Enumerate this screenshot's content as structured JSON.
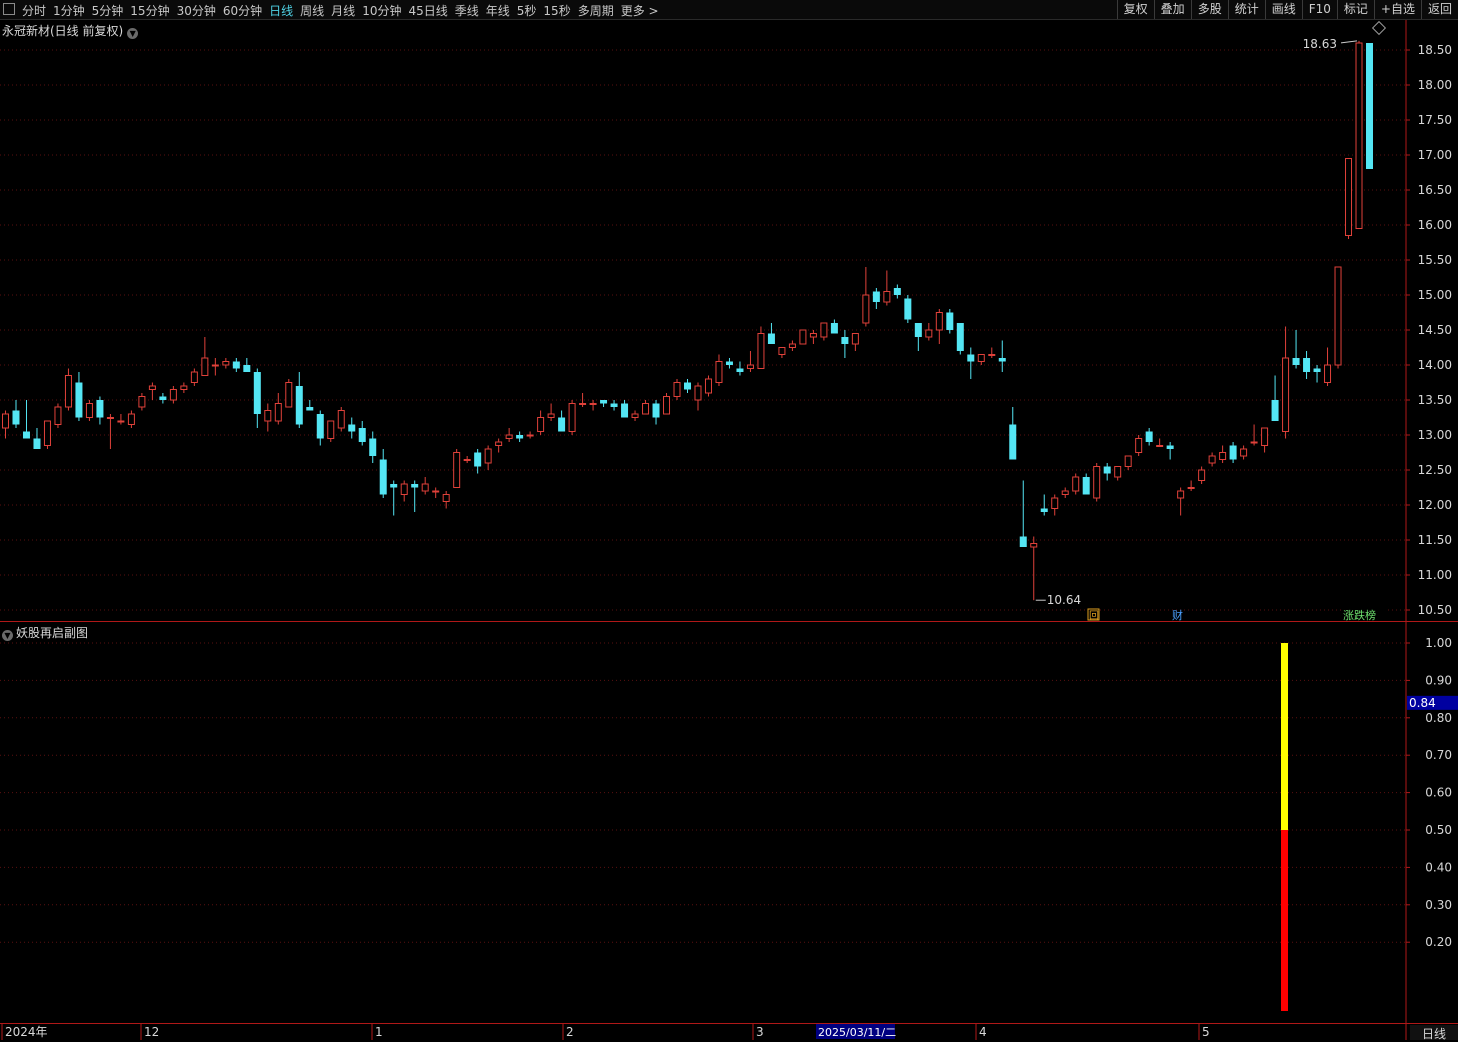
{
  "toolbar": {
    "tabs": [
      "分时",
      "1分钟",
      "5分钟",
      "15分钟",
      "30分钟",
      "60分钟",
      "日线",
      "周线",
      "月线",
      "10分钟",
      "45日线",
      "季线",
      "年线",
      "5秒",
      "15秒",
      "多周期",
      "更多 >"
    ],
    "active_tab": "日线",
    "right_buttons": [
      "复权",
      "叠加",
      "多股",
      "统计",
      "画线",
      "F10",
      "标记",
      "+自选",
      "返回"
    ]
  },
  "main_chart": {
    "title": "永冠新材(日线 前复权)",
    "price_axis": [
      "18.50",
      "18.00",
      "17.50",
      "17.00",
      "16.50",
      "16.00",
      "15.50",
      "15.00",
      "14.50",
      "14.00",
      "13.50",
      "13.00",
      "12.50",
      "12.00",
      "11.50",
      "11.00",
      "10.50"
    ],
    "high_label": "18.63",
    "low_label": "10.64",
    "markers": {
      "hui": "回",
      "cai": "财",
      "tags": "涨跌榜"
    }
  },
  "sub_chart": {
    "title": "妖股再启副图",
    "axis": [
      "1.00",
      "0.90",
      "0.80",
      "0.70",
      "0.60",
      "0.50",
      "0.40",
      "0.30",
      "0.20"
    ],
    "current_value": "0.84"
  },
  "time_axis": {
    "labels": [
      "2024年",
      "12",
      "1",
      "2",
      "3",
      "4",
      "5"
    ],
    "highlight_date": "2025/03/11/二",
    "period": "日线"
  },
  "colors": {
    "up": "#e0413a",
    "down": "#54e6f4",
    "grid": "#5a1010",
    "axis_line": "#b01818",
    "yellow": "#ffff00",
    "red_bar": "#ff0000"
  },
  "chart_data": {
    "type": "candlestick",
    "ylim": [
      10.4,
      18.8
    ],
    "candles": [
      {
        "o": 13.1,
        "h": 13.35,
        "l": 12.95,
        "c": 13.3
      },
      {
        "o": 13.35,
        "h": 13.5,
        "l": 13.1,
        "c": 13.15
      },
      {
        "o": 13.05,
        "h": 13.5,
        "l": 13.0,
        "c": 12.95
      },
      {
        "o": 12.95,
        "h": 13.1,
        "l": 12.8,
        "c": 12.8
      },
      {
        "o": 12.85,
        "h": 13.2,
        "l": 12.8,
        "c": 13.2
      },
      {
        "o": 13.15,
        "h": 13.45,
        "l": 13.1,
        "c": 13.4
      },
      {
        "o": 13.4,
        "h": 13.95,
        "l": 13.35,
        "c": 13.85
      },
      {
        "o": 13.75,
        "h": 13.9,
        "l": 13.2,
        "c": 13.25
      },
      {
        "o": 13.25,
        "h": 13.5,
        "l": 13.2,
        "c": 13.45
      },
      {
        "o": 13.5,
        "h": 13.55,
        "l": 13.15,
        "c": 13.25
      },
      {
        "o": 13.25,
        "h": 13.3,
        "l": 12.8,
        "c": 13.25
      },
      {
        "o": 13.2,
        "h": 13.3,
        "l": 13.15,
        "c": 13.2
      },
      {
        "o": 13.15,
        "h": 13.35,
        "l": 13.1,
        "c": 13.3
      },
      {
        "o": 13.4,
        "h": 13.6,
        "l": 13.35,
        "c": 13.55
      },
      {
        "o": 13.65,
        "h": 13.75,
        "l": 13.5,
        "c": 13.7
      },
      {
        "o": 13.55,
        "h": 13.6,
        "l": 13.45,
        "c": 13.5
      },
      {
        "o": 13.5,
        "h": 13.7,
        "l": 13.45,
        "c": 13.65
      },
      {
        "o": 13.65,
        "h": 13.75,
        "l": 13.6,
        "c": 13.7
      },
      {
        "o": 13.75,
        "h": 13.95,
        "l": 13.7,
        "c": 13.9
      },
      {
        "o": 13.85,
        "h": 14.4,
        "l": 13.85,
        "c": 14.1
      },
      {
        "o": 14.0,
        "h": 14.1,
        "l": 13.85,
        "c": 14.0
      },
      {
        "o": 14.0,
        "h": 14.1,
        "l": 13.95,
        "c": 14.05
      },
      {
        "o": 14.05,
        "h": 14.1,
        "l": 13.9,
        "c": 13.95
      },
      {
        "o": 14.0,
        "h": 14.1,
        "l": 13.9,
        "c": 13.9
      },
      {
        "o": 13.9,
        "h": 13.95,
        "l": 13.1,
        "c": 13.3
      },
      {
        "o": 13.2,
        "h": 13.45,
        "l": 13.05,
        "c": 13.35
      },
      {
        "o": 13.2,
        "h": 13.6,
        "l": 13.15,
        "c": 13.45
      },
      {
        "o": 13.4,
        "h": 13.8,
        "l": 13.4,
        "c": 13.75
      },
      {
        "o": 13.7,
        "h": 13.9,
        "l": 13.1,
        "c": 13.15
      },
      {
        "o": 13.4,
        "h": 13.5,
        "l": 13.35,
        "c": 13.35
      },
      {
        "o": 13.3,
        "h": 13.35,
        "l": 12.85,
        "c": 12.95
      },
      {
        "o": 12.95,
        "h": 13.1,
        "l": 12.9,
        "c": 13.2
      },
      {
        "o": 13.1,
        "h": 13.4,
        "l": 13.05,
        "c": 13.35
      },
      {
        "o": 13.15,
        "h": 13.25,
        "l": 12.95,
        "c": 13.05
      },
      {
        "o": 13.1,
        "h": 13.2,
        "l": 12.85,
        "c": 12.9
      },
      {
        "o": 12.95,
        "h": 13.05,
        "l": 12.6,
        "c": 12.7
      },
      {
        "o": 12.65,
        "h": 12.8,
        "l": 12.1,
        "c": 12.15
      },
      {
        "o": 12.3,
        "h": 12.35,
        "l": 11.85,
        "c": 12.25
      },
      {
        "o": 12.15,
        "h": 12.35,
        "l": 12.05,
        "c": 12.3
      },
      {
        "o": 12.3,
        "h": 12.35,
        "l": 11.9,
        "c": 12.25
      },
      {
        "o": 12.2,
        "h": 12.4,
        "l": 12.15,
        "c": 12.3
      },
      {
        "o": 12.2,
        "h": 12.25,
        "l": 12.1,
        "c": 12.2
      },
      {
        "o": 12.05,
        "h": 12.2,
        "l": 11.95,
        "c": 12.15
      },
      {
        "o": 12.25,
        "h": 12.8,
        "l": 12.25,
        "c": 12.75
      },
      {
        "o": 12.65,
        "h": 12.7,
        "l": 12.6,
        "c": 12.65
      },
      {
        "o": 12.75,
        "h": 12.8,
        "l": 12.45,
        "c": 12.55
      },
      {
        "o": 12.6,
        "h": 12.85,
        "l": 12.5,
        "c": 12.8
      },
      {
        "o": 12.85,
        "h": 12.95,
        "l": 12.75,
        "c": 12.9
      },
      {
        "o": 12.95,
        "h": 13.1,
        "l": 12.9,
        "c": 13.0
      },
      {
        "o": 13.0,
        "h": 13.05,
        "l": 12.9,
        "c": 12.95
      },
      {
        "o": 13.0,
        "h": 13.05,
        "l": 12.95,
        "c": 13.0
      },
      {
        "o": 13.05,
        "h": 13.35,
        "l": 13.0,
        "c": 13.25
      },
      {
        "o": 13.25,
        "h": 13.45,
        "l": 13.2,
        "c": 13.3
      },
      {
        "o": 13.25,
        "h": 13.35,
        "l": 13.05,
        "c": 13.05
      },
      {
        "o": 13.05,
        "h": 13.5,
        "l": 13.0,
        "c": 13.45
      },
      {
        "o": 13.45,
        "h": 13.6,
        "l": 13.4,
        "c": 13.45
      },
      {
        "o": 13.45,
        "h": 13.5,
        "l": 13.35,
        "c": 13.45
      },
      {
        "o": 13.5,
        "h": 13.5,
        "l": 13.4,
        "c": 13.45
      },
      {
        "o": 13.45,
        "h": 13.5,
        "l": 13.35,
        "c": 13.4
      },
      {
        "o": 13.45,
        "h": 13.5,
        "l": 13.25,
        "c": 13.25
      },
      {
        "o": 13.25,
        "h": 13.35,
        "l": 13.2,
        "c": 13.3
      },
      {
        "o": 13.3,
        "h": 13.5,
        "l": 13.3,
        "c": 13.45
      },
      {
        "o": 13.45,
        "h": 13.5,
        "l": 13.15,
        "c": 13.25
      },
      {
        "o": 13.3,
        "h": 13.6,
        "l": 13.3,
        "c": 13.55
      },
      {
        "o": 13.55,
        "h": 13.8,
        "l": 13.5,
        "c": 13.75
      },
      {
        "o": 13.75,
        "h": 13.8,
        "l": 13.6,
        "c": 13.65
      },
      {
        "o": 13.5,
        "h": 13.75,
        "l": 13.35,
        "c": 13.7
      },
      {
        "o": 13.6,
        "h": 13.85,
        "l": 13.55,
        "c": 13.8
      },
      {
        "o": 13.75,
        "h": 14.15,
        "l": 13.7,
        "c": 14.05
      },
      {
        "o": 14.05,
        "h": 14.1,
        "l": 13.95,
        "c": 14.0
      },
      {
        "o": 13.95,
        "h": 14.05,
        "l": 13.85,
        "c": 13.9
      },
      {
        "o": 13.95,
        "h": 14.2,
        "l": 13.9,
        "c": 14.0
      },
      {
        "o": 13.95,
        "h": 14.55,
        "l": 13.95,
        "c": 14.45
      },
      {
        "o": 14.45,
        "h": 14.6,
        "l": 14.3,
        "c": 14.3
      },
      {
        "o": 14.15,
        "h": 14.25,
        "l": 14.1,
        "c": 14.25
      },
      {
        "o": 14.25,
        "h": 14.35,
        "l": 14.2,
        "c": 14.3
      },
      {
        "o": 14.3,
        "h": 14.5,
        "l": 14.3,
        "c": 14.5
      },
      {
        "o": 14.4,
        "h": 14.5,
        "l": 14.3,
        "c": 14.45
      },
      {
        "o": 14.4,
        "h": 14.6,
        "l": 14.35,
        "c": 14.6
      },
      {
        "o": 14.6,
        "h": 14.65,
        "l": 14.45,
        "c": 14.45
      },
      {
        "o": 14.4,
        "h": 14.5,
        "l": 14.1,
        "c": 14.3
      },
      {
        "o": 14.3,
        "h": 14.45,
        "l": 14.2,
        "c": 14.45
      },
      {
        "o": 14.6,
        "h": 15.4,
        "l": 14.55,
        "c": 15.0
      },
      {
        "o": 15.05,
        "h": 15.1,
        "l": 14.8,
        "c": 14.9
      },
      {
        "o": 14.9,
        "h": 15.35,
        "l": 14.85,
        "c": 15.05
      },
      {
        "o": 15.1,
        "h": 15.15,
        "l": 14.95,
        "c": 15.0
      },
      {
        "o": 14.95,
        "h": 15.0,
        "l": 14.6,
        "c": 14.65
      },
      {
        "o": 14.6,
        "h": 14.6,
        "l": 14.2,
        "c": 14.4
      },
      {
        "o": 14.4,
        "h": 14.6,
        "l": 14.35,
        "c": 14.5
      },
      {
        "o": 14.5,
        "h": 14.8,
        "l": 14.3,
        "c": 14.75
      },
      {
        "o": 14.75,
        "h": 14.8,
        "l": 14.45,
        "c": 14.5
      },
      {
        "o": 14.6,
        "h": 14.6,
        "l": 14.15,
        "c": 14.2
      },
      {
        "o": 14.15,
        "h": 14.25,
        "l": 13.8,
        "c": 14.05
      },
      {
        "o": 14.05,
        "h": 14.15,
        "l": 14.0,
        "c": 14.15
      },
      {
        "o": 14.15,
        "h": 14.25,
        "l": 14.1,
        "c": 14.15
      },
      {
        "o": 14.1,
        "h": 14.35,
        "l": 13.9,
        "c": 14.05
      },
      {
        "o": 13.15,
        "h": 13.4,
        "l": 12.65,
        "c": 12.65
      },
      {
        "o": 11.55,
        "h": 12.35,
        "l": 11.4,
        "c": 11.4
      },
      {
        "o": 11.4,
        "h": 11.55,
        "l": 10.64,
        "c": 11.45
      },
      {
        "o": 11.95,
        "h": 12.15,
        "l": 11.85,
        "c": 11.9
      },
      {
        "o": 11.95,
        "h": 12.15,
        "l": 11.85,
        "c": 12.1
      },
      {
        "o": 12.15,
        "h": 12.25,
        "l": 12.1,
        "c": 12.2
      },
      {
        "o": 12.2,
        "h": 12.45,
        "l": 12.15,
        "c": 12.4
      },
      {
        "o": 12.4,
        "h": 12.45,
        "l": 12.15,
        "c": 12.15
      },
      {
        "o": 12.1,
        "h": 12.6,
        "l": 12.05,
        "c": 12.55
      },
      {
        "o": 12.55,
        "h": 12.6,
        "l": 12.35,
        "c": 12.45
      },
      {
        "o": 12.4,
        "h": 12.55,
        "l": 12.35,
        "c": 12.55
      },
      {
        "o": 12.55,
        "h": 12.7,
        "l": 12.5,
        "c": 12.7
      },
      {
        "o": 12.75,
        "h": 13.0,
        "l": 12.7,
        "c": 12.95
      },
      {
        "o": 13.05,
        "h": 13.1,
        "l": 12.85,
        "c": 12.9
      },
      {
        "o": 12.85,
        "h": 12.95,
        "l": 12.85,
        "c": 12.85
      },
      {
        "o": 12.85,
        "h": 12.9,
        "l": 12.65,
        "c": 12.8
      },
      {
        "o": 12.1,
        "h": 12.25,
        "l": 11.85,
        "c": 12.2
      },
      {
        "o": 12.25,
        "h": 12.35,
        "l": 12.2,
        "c": 12.25
      },
      {
        "o": 12.35,
        "h": 12.55,
        "l": 12.3,
        "c": 12.5
      },
      {
        "o": 12.6,
        "h": 12.75,
        "l": 12.55,
        "c": 12.7
      },
      {
        "o": 12.65,
        "h": 12.85,
        "l": 12.6,
        "c": 12.75
      },
      {
        "o": 12.85,
        "h": 12.9,
        "l": 12.6,
        "c": 12.65
      },
      {
        "o": 12.7,
        "h": 12.85,
        "l": 12.65,
        "c": 12.8
      },
      {
        "o": 12.9,
        "h": 13.15,
        "l": 12.85,
        "c": 12.9
      },
      {
        "o": 12.85,
        "h": 13.1,
        "l": 12.75,
        "c": 13.1
      },
      {
        "o": 13.5,
        "h": 13.85,
        "l": 13.2,
        "c": 13.2
      },
      {
        "o": 13.05,
        "h": 14.55,
        "l": 12.95,
        "c": 14.1
      },
      {
        "o": 14.1,
        "h": 14.5,
        "l": 13.95,
        "c": 14.0
      },
      {
        "o": 14.1,
        "h": 14.2,
        "l": 13.8,
        "c": 13.9
      },
      {
        "o": 13.95,
        "h": 14.0,
        "l": 13.75,
        "c": 13.9
      },
      {
        "o": 13.75,
        "h": 14.25,
        "l": 13.7,
        "c": 14.0
      },
      {
        "o": 14.0,
        "h": 15.4,
        "l": 13.95,
        "c": 15.4
      },
      {
        "o": 15.85,
        "h": 16.95,
        "l": 15.8,
        "c": 16.95
      },
      {
        "o": 15.95,
        "h": 18.63,
        "l": 15.95,
        "c": 18.6
      },
      {
        "o": 18.6,
        "h": 18.6,
        "l": 16.8,
        "c": 16.8
      }
    ],
    "indicator": {
      "yellow_top": 1.0,
      "yellow_bottom": 0.5,
      "red_bottom": 0.0
    }
  }
}
